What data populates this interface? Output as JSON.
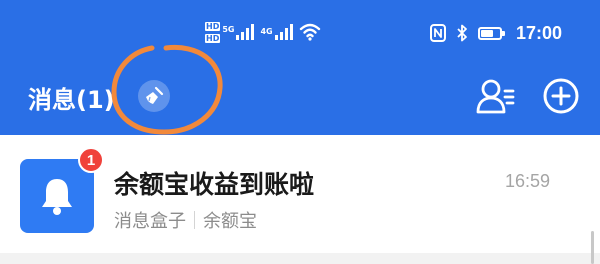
{
  "status_bar": {
    "network_labels": [
      "HD",
      "HD",
      "5G",
      "4G"
    ],
    "time": "17:00",
    "icons": [
      "signal-icon",
      "wifi-icon",
      "nfc-icon",
      "bluetooth-icon",
      "battery-icon"
    ],
    "battery_level": 0.6
  },
  "header": {
    "title": "消息(1)",
    "icons": [
      "clean-broom-icon",
      "contacts-icon",
      "add-icon"
    ],
    "background_color": "#2a6fe6",
    "annotation_color": "#f2893b"
  },
  "messages": [
    {
      "title": "余额宝收益到账啦",
      "source": "消息盒子",
      "category": "余额宝",
      "time": "16:59",
      "unread_count": "1",
      "icon": "bell-icon"
    }
  ]
}
